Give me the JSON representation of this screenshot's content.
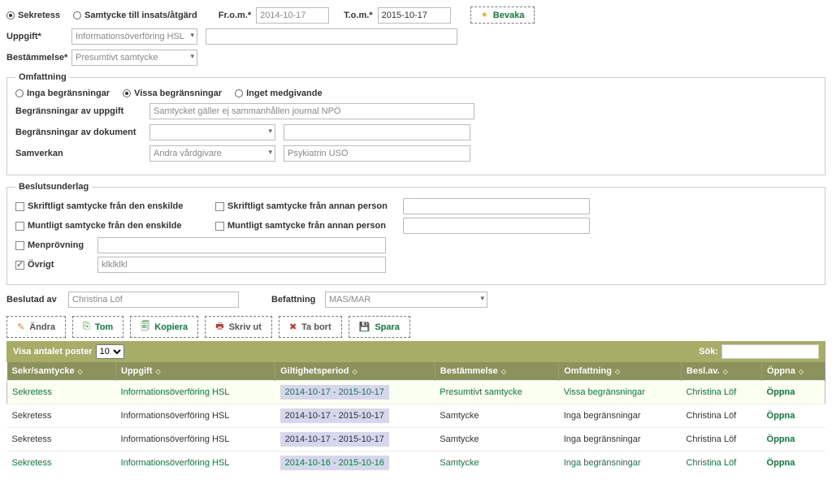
{
  "top": {
    "sekretess": "Sekretess",
    "samtycke": "Samtycke till insats/åtgärd",
    "from_lbl": "Fr.o.m.",
    "tom_lbl": "T.o.m.",
    "from_val": "2014-10-17",
    "tom_val": "2015-10-17",
    "bevaka": "Bevaka"
  },
  "uppgift": {
    "label": "Uppgift",
    "sel": "Informationsöverföring HSL"
  },
  "bestammelse": {
    "label": "Bestämmelse",
    "sel": "Presumtivt samtycke"
  },
  "omfattning": {
    "legend": "Omfattning",
    "r1": "Inga begränsningar",
    "r2": "Vissa begränsningar",
    "r3": "Inget medgivande",
    "begr_uppg_lbl": "Begränsningar av uppgift",
    "begr_uppg_val": "Samtycket gäller ej sammanhållen journal NPÖ",
    "begr_dok_lbl": "Begränsningar av dokument",
    "samverkan_lbl": "Samverkan",
    "samverkan_sel": "Andra vårdgivare",
    "samverkan_txt": "Psykiatrin USÖ"
  },
  "besluts": {
    "legend": "Beslutsunderlag",
    "c1": "Skriftligt samtycke från den enskilde",
    "c2": "Skriftligt samtycke från annan person",
    "c3": "Muntligt samtycke från den enskilde",
    "c4": "Muntligt samtycke från annan person",
    "c5": "Menprövning",
    "c6": "Övrigt",
    "ovrigt_val": "klklklkl"
  },
  "beslutad": {
    "av_lbl": "Beslutad av",
    "av_val": "Christina Löf",
    "bef_lbl": "Befattning",
    "bef_val": "MAS/MAR"
  },
  "toolbar": {
    "andra": "Ändra",
    "tom": "Tom",
    "kopiera": "Kopiera",
    "skrivut": "Skriv ut",
    "tabort": "Ta bort",
    "spara": "Spara"
  },
  "pager": {
    "label": "Visa antalet poster",
    "value": "10",
    "search_lbl": "Sök:"
  },
  "cols": {
    "c1": "Sekr/samtycke",
    "c2": "Uppgift",
    "c3": "Giltighetsperiod",
    "c4": "Bestämmelse",
    "c5": "Omfattning",
    "c6": "Besl.av.",
    "c7": "Öppna"
  },
  "rows": [
    {
      "sek": "Sekretess",
      "upp": "Informationsöverföring HSL",
      "per": "2014-10-17 - 2015-10-17",
      "best": "Presumtivt samtycke",
      "omf": "Vissa begränsningar",
      "av": "Christina Löf",
      "op": "Öppna"
    },
    {
      "sek": "Sekretess",
      "upp": "Informationsöverföring HSL",
      "per": "2014-10-17 - 2015-10-17",
      "best": "Samtycke",
      "omf": "Inga begränsningar",
      "av": "Christina Löf",
      "op": "Öppna"
    },
    {
      "sek": "Sekretess",
      "upp": "Informationsöverföring HSL",
      "per": "2014-10-17 - 2015-10-17",
      "best": "Samtycke",
      "omf": "Inga begränsningar",
      "av": "Christina Löf",
      "op": "Öppna"
    },
    {
      "sek": "Sekretess",
      "upp": "Informationsöverföring HSL",
      "per": "2014-10-16 - 2015-10-16",
      "best": "Samtycke",
      "omf": "Inga begränsningar",
      "av": "Christina Löf",
      "op": "Öppna"
    }
  ]
}
